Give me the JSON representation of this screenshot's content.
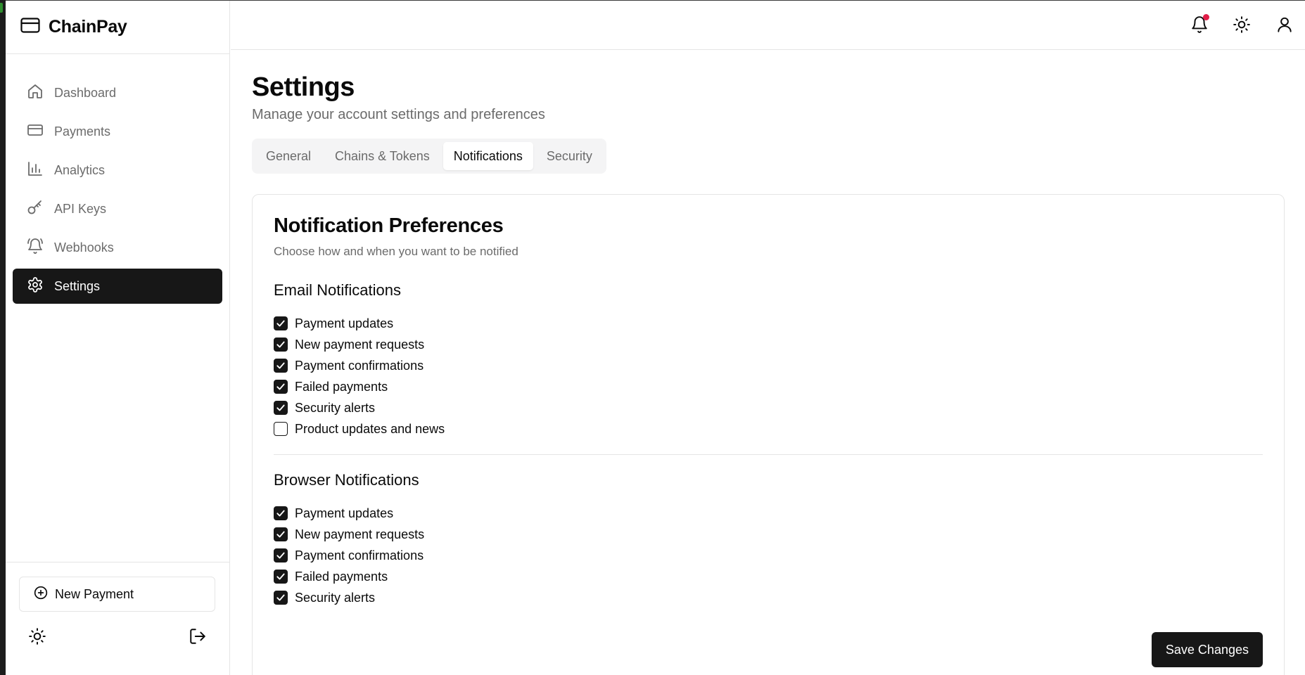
{
  "app": {
    "name": "ChainPay"
  },
  "sidebar": {
    "items": [
      {
        "label": "Dashboard",
        "icon": "home-icon",
        "active": false
      },
      {
        "label": "Payments",
        "icon": "credit-card-icon",
        "active": false
      },
      {
        "label": "Analytics",
        "icon": "bar-chart-icon",
        "active": false
      },
      {
        "label": "API Keys",
        "icon": "key-icon",
        "active": false
      },
      {
        "label": "Webhooks",
        "icon": "bell-ring-icon",
        "active": false
      },
      {
        "label": "Settings",
        "icon": "gear-icon",
        "active": true
      }
    ],
    "new_payment_label": "New Payment"
  },
  "header": {
    "icons": [
      "bell-icon",
      "sun-icon",
      "user-icon"
    ],
    "notification_dot_color": "#e11d48"
  },
  "page": {
    "title": "Settings",
    "subtitle": "Manage your account settings and preferences"
  },
  "tabs": [
    {
      "label": "General",
      "active": false
    },
    {
      "label": "Chains & Tokens",
      "active": false
    },
    {
      "label": "Notifications",
      "active": true
    },
    {
      "label": "Security",
      "active": false
    }
  ],
  "card": {
    "title": "Notification Preferences",
    "subtitle": "Choose how and when you want to be notified",
    "email": {
      "title": "Email Notifications",
      "options": [
        {
          "label": "Payment updates",
          "checked": true
        },
        {
          "label": "New payment requests",
          "checked": true
        },
        {
          "label": "Payment confirmations",
          "checked": true
        },
        {
          "label": "Failed payments",
          "checked": true
        },
        {
          "label": "Security alerts",
          "checked": true
        },
        {
          "label": "Product updates and news",
          "checked": false
        }
      ]
    },
    "browser": {
      "title": "Browser Notifications",
      "options": [
        {
          "label": "Payment updates",
          "checked": true
        },
        {
          "label": "New payment requests",
          "checked": true
        },
        {
          "label": "Payment confirmations",
          "checked": true
        },
        {
          "label": "Failed payments",
          "checked": true
        },
        {
          "label": "Security alerts",
          "checked": true
        }
      ]
    },
    "save_label": "Save Changes"
  },
  "colors": {
    "accent_dark": "#171717",
    "muted_text": "#6b6b6b",
    "border": "#e5e5e5"
  }
}
